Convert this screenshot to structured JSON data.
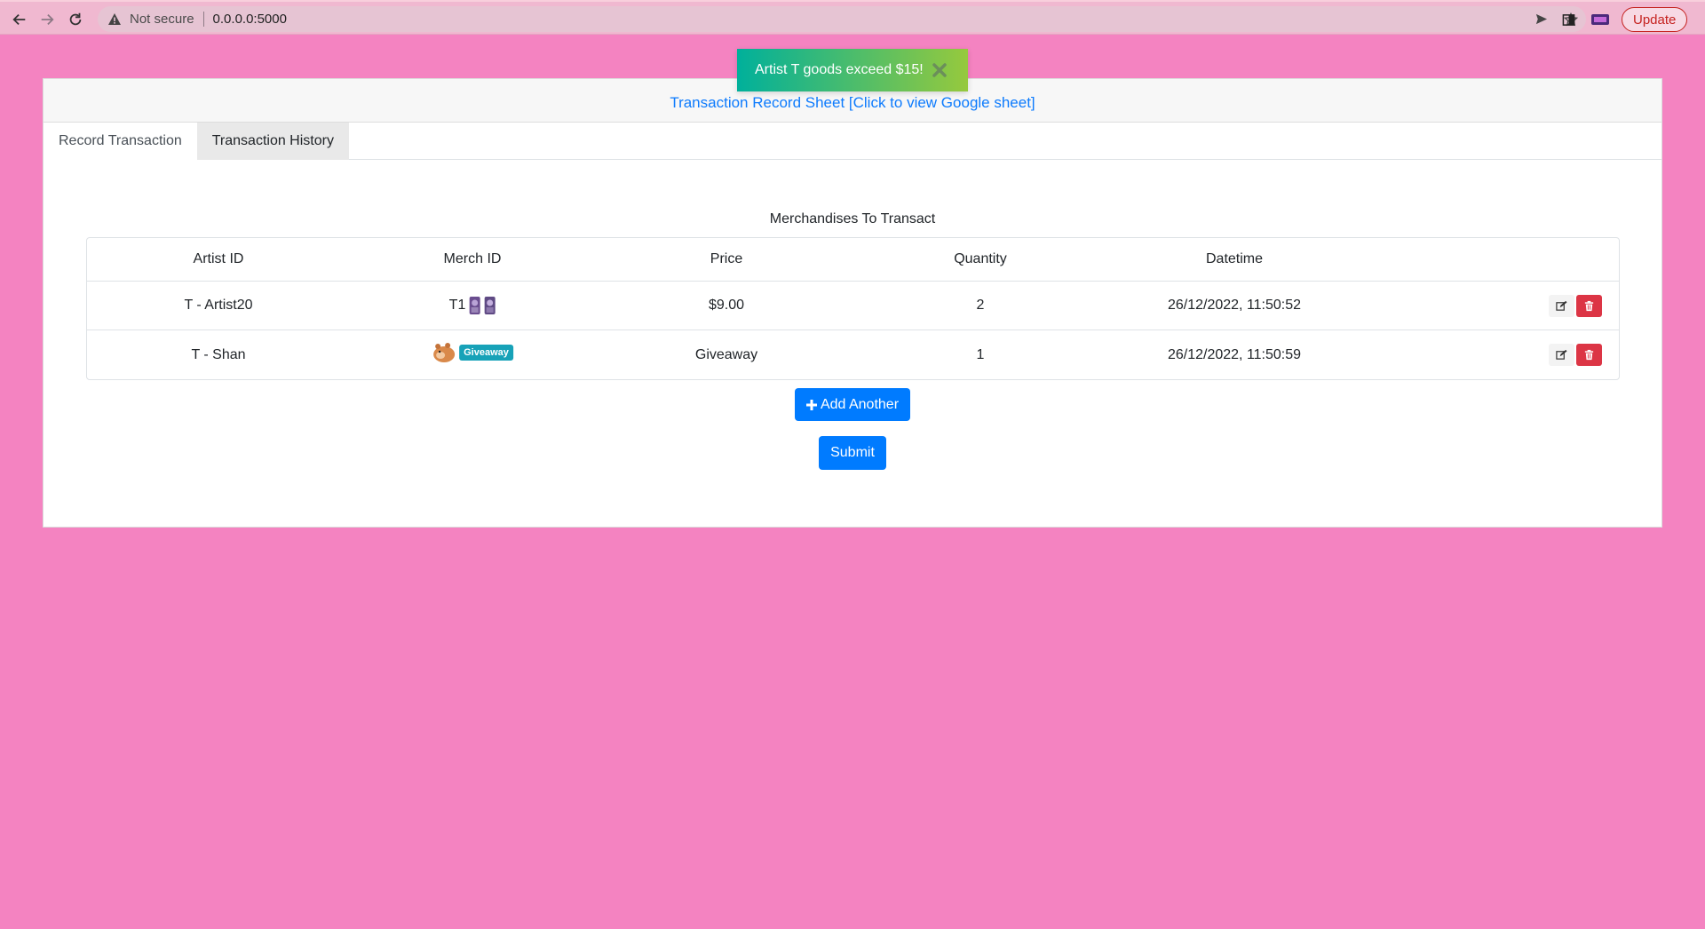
{
  "browser": {
    "security_label": "Not secure",
    "url": "0.0.0.0:5000",
    "update_label": "Update"
  },
  "toast": {
    "message": "Artist T goods exceed $15!"
  },
  "card": {
    "header_link": "Transaction Record Sheet [Click to view Google sheet]",
    "tabs": [
      {
        "label": "Record Transaction",
        "active": true
      },
      {
        "label": "Transaction History",
        "active": false
      }
    ],
    "section_title": "Merchandises To Transact"
  },
  "table": {
    "columns": [
      "Artist ID",
      "Merch ID",
      "Price",
      "Quantity",
      "Datetime"
    ],
    "rows": [
      {
        "artist": "T - Artist20",
        "merch": "T1",
        "price": "$9.00",
        "quantity": "2",
        "datetime": "26/12/2022, 11:50:52"
      },
      {
        "artist": "T - Shan",
        "merch_badge": "Giveaway",
        "price": "Giveaway",
        "quantity": "1",
        "datetime": "26/12/2022, 11:50:59"
      }
    ]
  },
  "buttons": {
    "add_another": "Add Another",
    "submit": "Submit"
  },
  "colors": {
    "page_bg": "#f483c1",
    "primary": "#007bff",
    "danger": "#dc3545",
    "badge": "#17a2b8",
    "link": "#0d7bfd"
  }
}
